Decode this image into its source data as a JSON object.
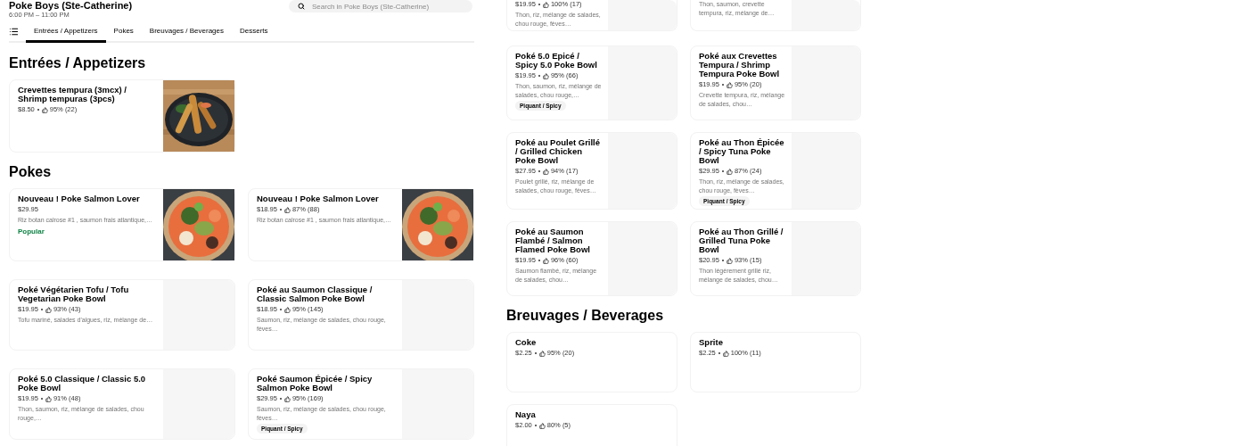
{
  "store": {
    "name": "Poke Boys (Ste-Catherine)",
    "hours": "6:00 PM – 11:00 PM"
  },
  "search": {
    "placeholder": "Search in Poke Boys (Ste-Catherine)"
  },
  "tabs": [
    {
      "label": "Entrées / Appetizers",
      "selected": true
    },
    {
      "label": "Pokes",
      "selected": false
    },
    {
      "label": "Breuvages / Beverages",
      "selected": false
    },
    {
      "label": "Desserts",
      "selected": false
    }
  ],
  "left_column": [
    {
      "kind": "heading",
      "text": "Entrées / Appetizers"
    },
    {
      "kind": "grid",
      "items": [
        {
          "name": "Crevettes tempura (3mcx) / Shrimp tempuras (3pcs)",
          "price": "$8.50",
          "rating": "95% (22)",
          "kind": "picture"
        }
      ]
    },
    {
      "kind": "heading",
      "text": "Pokes"
    },
    {
      "kind": "grid",
      "items": [
        {
          "name": "Nouveau ! Poke Salmon Lover",
          "price": "$29.95",
          "description": "Riz botan calrose #1 , saumon frais atlantique,…",
          "badge": "Popular",
          "kind": "picture"
        },
        {
          "name": "Nouveau ! Poke Salmon Lover",
          "price": "$18.95",
          "rating": "87% (88)",
          "description": "Riz botan calrose #1 , saumon frais atlantique,…",
          "kind": "picture"
        },
        {
          "name": "Poké Végétarien Tofu / Tofu Vegetarian Poke Bowl",
          "price": "$19.95",
          "rating": "93% (43)",
          "description": "Tofu mariné, salades d'algues, riz, mélange de…",
          "kind": "placeholder"
        },
        {
          "name": "Poké au Saumon Classique / Classic Salmon Poke Bowl",
          "price": "$18.95",
          "rating": "95% (145)",
          "description": "Saumon, riz, mélange de salades, chou rouge, fèves…",
          "kind": "placeholder"
        },
        {
          "name": "Poké 5.0 Classique / Classic 5.0 Poke Bowl",
          "price": "$19.95",
          "rating": "91% (48)",
          "description": "Thon, saumon, riz, mélange de salades, chou rouge,…",
          "kind": "placeholder"
        },
        {
          "name": "Poké Saumon Épicée / Spicy Salmon Poke Bowl",
          "price": "$29.95",
          "rating": "95% (169)",
          "description": "Saumon, riz, mélange de salades, chou rouge, fèves…",
          "tag": "Piquant / Spicy",
          "kind": "placeholder"
        }
      ]
    }
  ],
  "right_column": [
    {
      "kind": "grid",
      "cut": true,
      "items": [
        {
          "price": "$19.95",
          "rating": "100% (17)",
          "description": "Thon, riz, mélange de salades, chou rouge, fèves…",
          "kind": "placeholder"
        },
        {
          "description": "Thon, saumon, crevette tempura, riz, mélange de…",
          "kind": "placeholder"
        }
      ]
    },
    {
      "kind": "grid",
      "items": [
        {
          "name": "Poké 5.0 Epicé / Spicy 5.0 Poke Bowl",
          "price": "$19.95",
          "rating": "95% (66)",
          "description": "Thon, saumon, riz, mélange de salades, chou rouge,…",
          "tag": "Piquant / Spicy",
          "kind": "placeholder"
        },
        {
          "name": "Poké aux Crevettes Tempura / Shrimp Tempura Poke Bowl",
          "price": "$19.95",
          "rating": "95% (20)",
          "description": "Crevette tempura, riz, mélange de salades, chou…",
          "kind": "placeholder"
        },
        {
          "name": "Poké au Poulet Grillé / Grilled Chicken Poke Bowl",
          "price": "$27.95",
          "rating": "94% (17)",
          "description": "Poulet grillé, riz, mélange de salades, chou rouge, fèves…",
          "kind": "placeholder"
        },
        {
          "name": "Poké au Thon Épicée / Spicy Tuna Poke Bowl",
          "price": "$29.95",
          "rating": "87% (24)",
          "description": "Thon, riz, mélange de salades, chou rouge, fèves…",
          "tag": "Piquant / Spicy",
          "kind": "placeholder"
        },
        {
          "name": "Poké au Saumon Flambé / Salmon Flamed Poke Bowl",
          "price": "$19.95",
          "rating": "96% (60)",
          "description": "Saumon flambé, riz, mélange de salades, chou…",
          "kind": "placeholder"
        },
        {
          "name": "Poké au Thon Grillé / Grilled Tuna Poke Bowl",
          "price": "$20.95",
          "rating": "93% (15)",
          "description": "Thon légèrement grillé riz, mélange de salades, chou…",
          "kind": "placeholder"
        }
      ]
    },
    {
      "kind": "heading",
      "text": "Breuvages / Beverages"
    },
    {
      "kind": "grid",
      "items": [
        {
          "name": "Coke",
          "price": "$2.25",
          "rating": "95% (20)"
        },
        {
          "name": "Sprite",
          "price": "$2.25",
          "rating": "100% (11)"
        },
        {
          "name": "Naya",
          "price": "$2.00",
          "rating": "80% (5)"
        }
      ]
    }
  ]
}
